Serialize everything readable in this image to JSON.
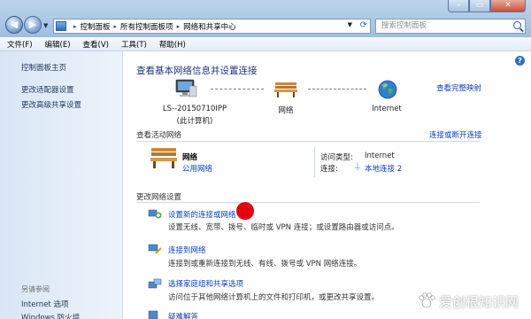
{
  "window": {
    "minimize_glyph": "–",
    "maximize_glyph": "▭",
    "close_glyph": "✕"
  },
  "address_bar": {
    "crumbs": [
      "控制面板",
      "所有控制面板项",
      "网络和共享中心"
    ],
    "separator": "▸"
  },
  "search": {
    "placeholder": "搜索控制面板"
  },
  "menu": [
    "文件(F)",
    "编辑(E)",
    "查看(V)",
    "工具(T)",
    "帮助(H)"
  ],
  "sidebar": {
    "items": [
      {
        "label": "控制面板主页"
      },
      {
        "label": "更改适配器设置"
      },
      {
        "label": "更改高级共享设置"
      }
    ],
    "see_also_label": "另请参阅",
    "see_also_items": [
      {
        "label": "Internet 选项"
      },
      {
        "label": "Windows 防火墙"
      }
    ]
  },
  "main": {
    "title": "查看基本网络信息并设置连接",
    "full_map_link": "查看完整映射",
    "nodes": [
      {
        "label_line1": "LS--20150710IPP",
        "label_line2": "(此计算机)",
        "icon": "computer-icon"
      },
      {
        "label_line1": "网络",
        "label_line2": "",
        "icon": "bench-icon"
      },
      {
        "label_line1": "Internet",
        "label_line2": "",
        "icon": "globe-icon"
      }
    ],
    "active_networks": {
      "label": "查看活动网络",
      "connect_link": "连接或断开连接",
      "network_name": "网络",
      "network_type": "公用网络",
      "access_type_label": "访问类型:",
      "access_type_value": "Internet",
      "connections_label": "连接:",
      "connections_value": "本地连接 2"
    },
    "change_settings": {
      "label": "更改网络设置",
      "tasks": [
        {
          "link": "设置新的连接或网络",
          "desc": "设置无线、宽带、拨号、临时或 VPN 连接；或设置路由器或访问点。",
          "icon": "new-connection-icon"
        },
        {
          "link": "连接到网络",
          "desc": "连接到或重新连接到无线、有线、拨号或 VPN 网络连接。",
          "icon": "connect-network-icon"
        },
        {
          "link": "选择家庭组和共享选项",
          "desc": "访问位于其他网络计算机上的文件和打印机，或更改共享设置。",
          "icon": "homegroup-icon"
        },
        {
          "link": "疑难解答",
          "desc": "",
          "icon": "troubleshoot-icon"
        }
      ]
    }
  },
  "watermark": {
    "text": "爱创根知识网"
  },
  "colors": {
    "link": "#0a3fbf",
    "title": "#1e3287",
    "marker": "#e60012"
  }
}
